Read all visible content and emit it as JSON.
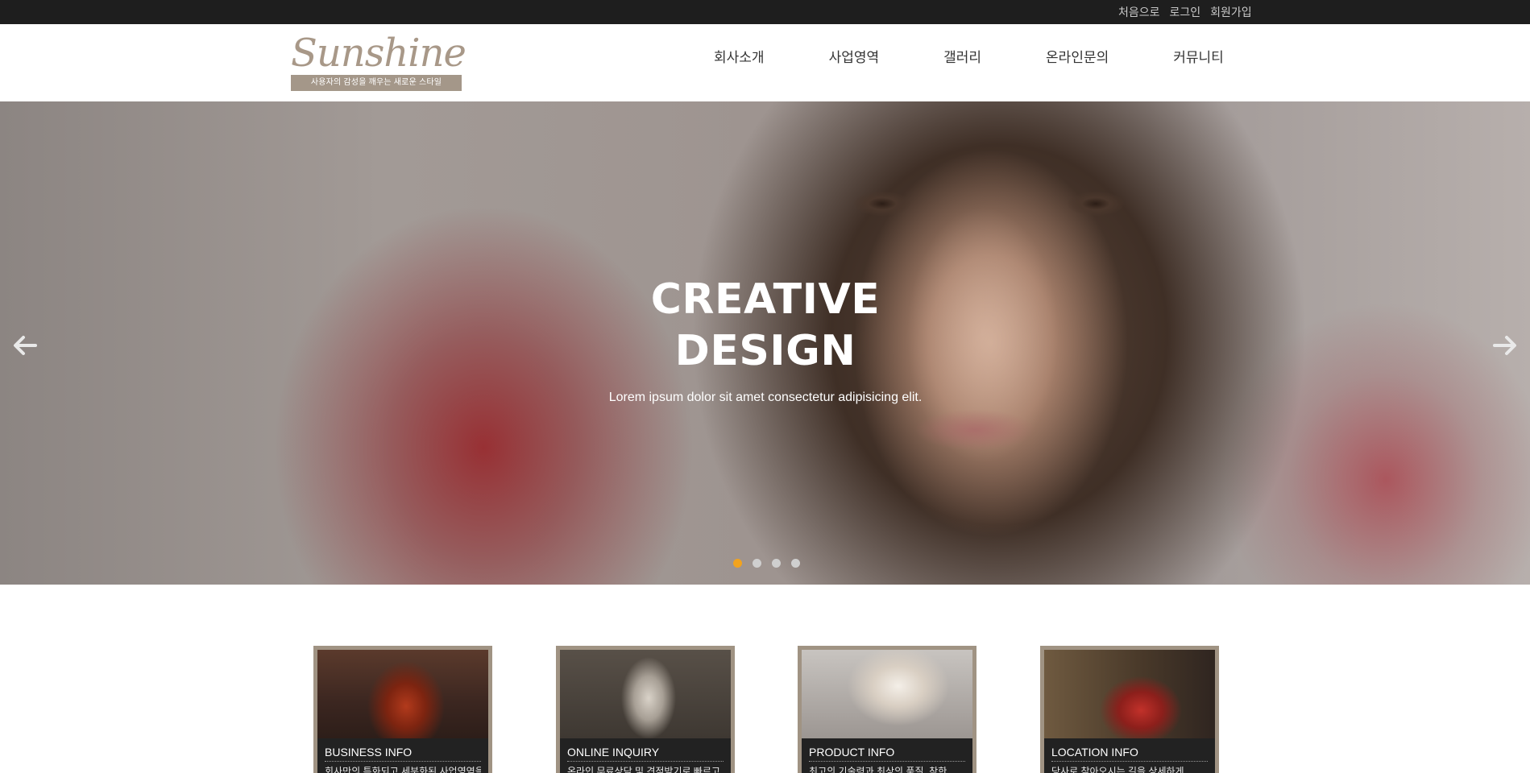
{
  "topbar": {
    "links": [
      "처음으로",
      "로그인",
      "회원가입"
    ]
  },
  "logo": {
    "name": "Sunshine",
    "tagline": "사용자의 감성을 깨우는 새로운 스타일"
  },
  "nav": {
    "items": [
      "회사소개",
      "사업영역",
      "갤러리",
      "온라인문의",
      "커뮤니티"
    ]
  },
  "hero": {
    "title_line1": "CREATIVE",
    "title_line2": "DESIGN",
    "description": "Lorem ipsum dolor sit amet consectetur adipisicing elit.",
    "slide_count": 4,
    "active_slide": 1,
    "prev_icon": "arrow-left-icon",
    "next_icon": "arrow-right-icon",
    "active_dot_color": "#f2a31d"
  },
  "cards": [
    {
      "title": "BUSINESS INFO",
      "text": "회사만의 특화되고 세분화된 사업영역을"
    },
    {
      "title": "ONLINE INQUIRY",
      "text": "온라인 무료상담 및 견적받기로 빠르고"
    },
    {
      "title": "PRODUCT INFO",
      "text": "최고의 기술력과 최상의 품질, 착한"
    },
    {
      "title": "LOCATION INFO",
      "text": "당사로 찾아오시는 길을 상세하게"
    }
  ],
  "colors": {
    "topbar": "#1e1e1e",
    "card_frame": "#a09383",
    "card_body": "#222222"
  }
}
